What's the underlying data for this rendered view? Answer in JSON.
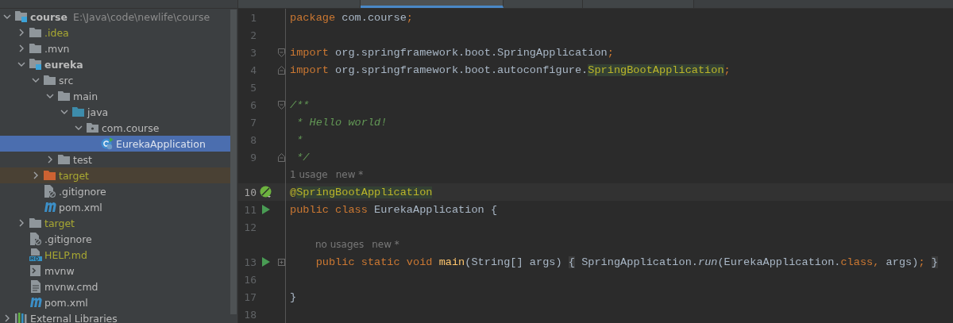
{
  "tabs": [
    {
      "selected": false
    },
    {
      "selected": true
    },
    {
      "selected": false
    },
    {
      "selected": false
    }
  ],
  "project_tree": [
    {
      "label": "course",
      "path": "E:\\Java\\code\\newlife\\course",
      "kind": "module",
      "bold": true,
      "expanded": true,
      "selected": false,
      "ignored": false,
      "excluded": false,
      "children": [
        {
          "label": ".idea",
          "kind": "folder",
          "expanded": false,
          "selected": false,
          "ignored": true,
          "excluded": false
        },
        {
          "label": ".mvn",
          "kind": "folder",
          "expanded": false,
          "selected": false,
          "ignored": false,
          "excluded": false
        },
        {
          "label": "eureka",
          "kind": "module",
          "bold": true,
          "expanded": true,
          "selected": false,
          "ignored": false,
          "excluded": false,
          "children": [
            {
              "label": "src",
              "kind": "folder",
              "expanded": true,
              "selected": false,
              "ignored": false,
              "excluded": false,
              "children": [
                {
                  "label": "main",
                  "kind": "folder",
                  "expanded": true,
                  "selected": false,
                  "ignored": false,
                  "excluded": false,
                  "children": [
                    {
                      "label": "java",
                      "kind": "source",
                      "expanded": true,
                      "selected": false,
                      "ignored": false,
                      "excluded": false,
                      "children": [
                        {
                          "label": "com.course",
                          "kind": "package",
                          "expanded": true,
                          "selected": false,
                          "ignored": false,
                          "excluded": false,
                          "children": [
                            {
                              "label": "EurekaApplication",
                              "kind": "class",
                              "selected": true,
                              "ignored": false,
                              "excluded": false
                            }
                          ]
                        }
                      ]
                    }
                  ]
                },
                {
                  "label": "test",
                  "kind": "folder",
                  "expanded": false,
                  "selected": false,
                  "ignored": false,
                  "excluded": false
                }
              ]
            },
            {
              "label": "target",
              "kind": "folder",
              "expanded": false,
              "selected": false,
              "ignored": true,
              "excluded": true
            },
            {
              "label": ".gitignore",
              "kind": "ignore",
              "selected": false,
              "ignored": false,
              "excluded": false
            },
            {
              "label": "pom.xml",
              "kind": "maven",
              "selected": false,
              "ignored": false,
              "excluded": false
            }
          ]
        },
        {
          "label": "target",
          "kind": "folder",
          "expanded": false,
          "selected": false,
          "ignored": true,
          "excluded": false
        },
        {
          "label": ".gitignore",
          "kind": "ignore",
          "selected": false,
          "ignored": false,
          "excluded": false
        },
        {
          "label": "HELP.md",
          "kind": "markdown",
          "selected": false,
          "ignored": true,
          "excluded": false
        },
        {
          "label": "mvnw",
          "kind": "script",
          "selected": false,
          "ignored": false,
          "excluded": false
        },
        {
          "label": "mvnw.cmd",
          "kind": "text",
          "selected": false,
          "ignored": false,
          "excluded": false
        },
        {
          "label": "pom.xml",
          "kind": "maven",
          "selected": false,
          "ignored": false,
          "excluded": false
        }
      ]
    },
    {
      "label": "External Libraries",
      "kind": "library",
      "expanded": false,
      "selected": false,
      "ignored": false,
      "excluded": false
    }
  ],
  "editor_lines": [
    {
      "kind": "code",
      "number": "1",
      "tokens": [
        {
          "text": "package",
          "kind": "keyword"
        },
        {
          "text": " com.course",
          "kind": "plain"
        },
        {
          "text": ";",
          "kind": "keyword"
        }
      ]
    },
    {
      "kind": "code",
      "number": "2"
    },
    {
      "kind": "code",
      "number": "3",
      "fold_marker": {
        "kind": "start"
      },
      "tokens": [
        {
          "text": "import",
          "kind": "keyword"
        },
        {
          "text": " org.springframework.boot.SpringApplication",
          "kind": "plain"
        },
        {
          "text": ";",
          "kind": "keyword"
        }
      ]
    },
    {
      "kind": "code",
      "number": "4",
      "fold_marker": {
        "kind": "end"
      },
      "tokens": [
        {
          "text": "import",
          "kind": "keyword"
        },
        {
          "text": " org.springframework.boot.autoconfigure.",
          "kind": "plain"
        },
        {
          "text": "SpringBootApplication",
          "kind": "annotation",
          "usage": true
        },
        {
          "text": ";",
          "kind": "keyword"
        }
      ]
    },
    {
      "kind": "code",
      "number": "5"
    },
    {
      "kind": "code",
      "number": "6",
      "fold_marker": {
        "kind": "start"
      },
      "tokens": [
        {
          "text": "/**",
          "kind": "doc"
        }
      ]
    },
    {
      "kind": "code",
      "number": "7",
      "tokens": [
        {
          "text": " * Hello world!",
          "kind": "doc"
        }
      ]
    },
    {
      "kind": "code",
      "number": "8",
      "tokens": [
        {
          "text": " *",
          "kind": "doc"
        }
      ]
    },
    {
      "kind": "code",
      "number": "9",
      "fold_marker": {
        "kind": "end"
      },
      "tokens": [
        {
          "text": " */",
          "kind": "doc"
        }
      ]
    },
    {
      "kind": "hint",
      "nested": false,
      "texts": [
        "1 usage",
        "new *"
      ]
    },
    {
      "kind": "code",
      "number": "10",
      "current": true,
      "gutter_icon": {
        "kind": "spring"
      },
      "tokens": [
        {
          "text": "@",
          "kind": "annotation"
        },
        {
          "text": "SpringBootApplication",
          "kind": "annotation",
          "usage": true
        }
      ]
    },
    {
      "kind": "code",
      "number": "11",
      "gutter_icon": {
        "kind": "run"
      },
      "tokens": [
        {
          "text": "public class ",
          "kind": "keyword"
        },
        {
          "text": "EurekaApplication {",
          "kind": "plain"
        }
      ]
    },
    {
      "kind": "code",
      "number": "12"
    },
    {
      "kind": "hint",
      "nested": true,
      "texts": [
        "no usages",
        "new *"
      ]
    },
    {
      "kind": "code",
      "number": "13",
      "gutter_icon": {
        "kind": "run"
      },
      "fold_marker": {
        "kind": "collapsed"
      },
      "tokens": [
        {
          "text": "    public static void ",
          "kind": "keyword"
        },
        {
          "text": "main",
          "kind": "method"
        },
        {
          "text": "(String[] args) ",
          "kind": "plain"
        },
        {
          "text": "{",
          "kind": "folded"
        },
        {
          "text": " SpringApplication.",
          "kind": "plain"
        },
        {
          "text": "run",
          "kind": "static"
        },
        {
          "text": "(EurekaApplication.",
          "kind": "plain"
        },
        {
          "text": "class",
          "kind": "keyword"
        },
        {
          "text": ",",
          "kind": "keyword"
        },
        {
          "text": " args)",
          "kind": "plain"
        },
        {
          "text": "; ",
          "kind": "keyword"
        },
        {
          "text": "}",
          "kind": "folded"
        }
      ]
    },
    {
      "kind": "code",
      "number": "16"
    },
    {
      "kind": "code",
      "number": "17",
      "tokens": [
        {
          "text": "}",
          "kind": "plain"
        }
      ]
    },
    {
      "kind": "code",
      "number": "18"
    }
  ]
}
